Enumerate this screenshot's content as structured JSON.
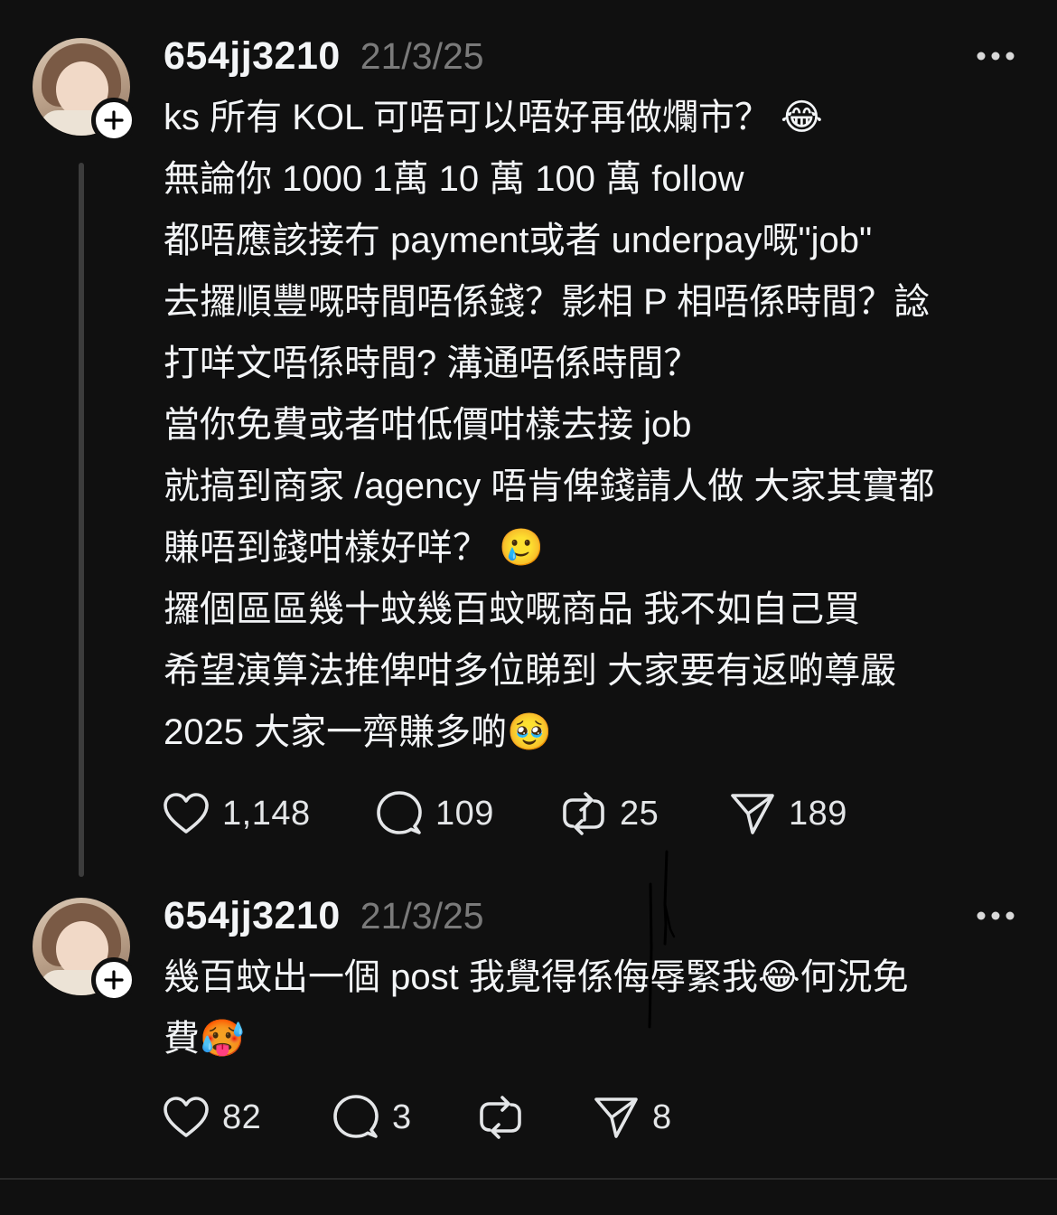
{
  "posts": [
    {
      "username": "654jj3210",
      "timestamp": "21/3/25",
      "more_label": "•••",
      "lines": [
        "ks 所有 KOL 可唔可以唔好再做爛市？ 😂",
        "無論你 1000 1萬 10 萬 100 萬 follow",
        "都唔應該接冇 payment或者 underpay嘅\"job\"",
        "去攞順豐嘅時間唔係錢？影相 P 相唔係時間？諗",
        "打咩文唔係時間? 溝通唔係時間？",
        "當你免費或者咁低價咁樣去接 job",
        "就搞到商家 /agency 唔肯俾錢請人做 大家其實都",
        "賺唔到錢咁樣好咩？ 🥲",
        "攞個區區幾十蚊幾百蚊嘅商品 我不如自己買",
        "希望演算法推俾咁多位睇到 大家要有返啲尊嚴",
        "2025 大家一齊賺多啲🥹"
      ],
      "likes": "1,148",
      "replies": "109",
      "reposts": "25",
      "shares": "189"
    },
    {
      "username": "654jj3210",
      "timestamp": "21/3/25",
      "more_label": "•••",
      "lines": [
        "幾百蚊出一個 post 我覺得係侮辱緊我😂何況免",
        "費🥵"
      ],
      "likes": "82",
      "replies": "3",
      "reposts": "",
      "shares": "8"
    }
  ],
  "icons": {
    "like": "heart-icon",
    "reply": "comment-icon",
    "repost": "repost-icon",
    "share": "send-icon",
    "follow": "plus-icon",
    "more": "more-icon"
  },
  "colors": {
    "background": "#101010",
    "text": "#f3f5f7",
    "muted": "#7a7a7a",
    "thread_line": "#3c3c3c"
  }
}
